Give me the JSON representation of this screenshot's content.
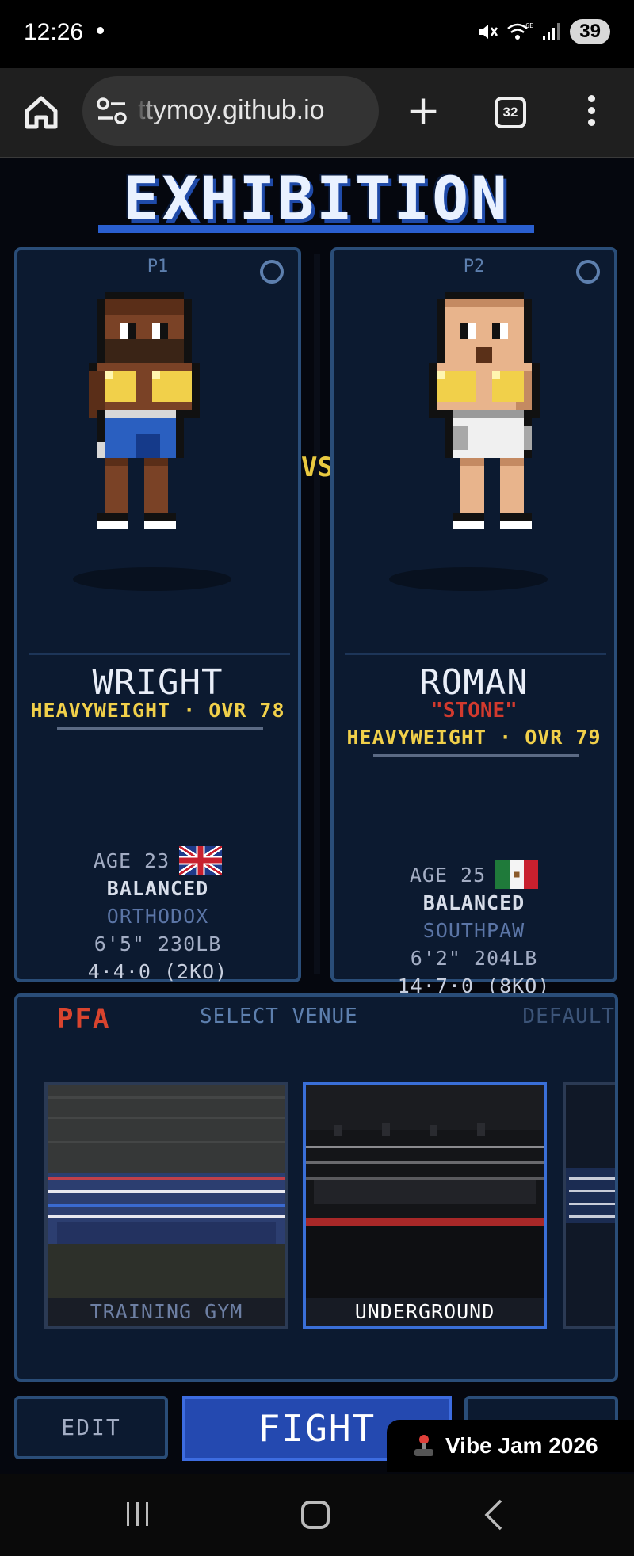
{
  "status_bar": {
    "time": "12:26",
    "battery": "39",
    "icons": [
      "mute-icon",
      "wifi-6e-icon",
      "signal-icon",
      "battery-icon"
    ]
  },
  "browser": {
    "url": "ttymoy.github.io",
    "tab_count": "32",
    "new_tab_label": "+"
  },
  "game": {
    "title": "EXHIBITION",
    "vs_label": "VS",
    "players": [
      {
        "tag": "P1",
        "name": "WRIGHT",
        "nickname": "",
        "class_line": "HEAVYWEIGHT · OVR 78",
        "age": "AGE 23",
        "flag": "uk-flag-icon",
        "style": "BALANCED",
        "stance": "ORTHODOX",
        "size": "6'5\" 230LB",
        "record": "4·4·0 (2KO)",
        "colors": {
          "skin": "#7a4226",
          "trunks": "#2a5fc0",
          "gloves": "#f1d04a"
        }
      },
      {
        "tag": "P2",
        "name": "ROMAN",
        "nickname": "\"STONE\"",
        "class_line": "HEAVYWEIGHT · OVR 79",
        "age": "AGE 25",
        "flag": "mexico-flag-icon",
        "style": "BALANCED",
        "stance": "SOUTHPAW",
        "size": "6'2\" 204LB",
        "record": "14·7·0 (8KO)",
        "colors": {
          "skin": "#e8b48c",
          "trunks": "#f0f0f0",
          "gloves": "#f1d04a"
        }
      }
    ],
    "venue": {
      "logo": "PFA",
      "label": "SELECT VENUE",
      "default_label": "DEFAULT",
      "options": [
        {
          "name": "TRAINING GYM",
          "selected": false
        },
        {
          "name": "UNDERGROUND",
          "selected": true
        }
      ]
    },
    "buttons": {
      "edit": "EDIT",
      "fight": "FIGHT"
    }
  },
  "badge": {
    "label": "Vibe Jam 2026",
    "icon": "joystick-icon"
  },
  "colors": {
    "accent": "#2449b0",
    "panel": "#0c1a30",
    "panel_border": "#2a4d78",
    "gold": "#f1d04a",
    "red": "#d23a2e"
  }
}
